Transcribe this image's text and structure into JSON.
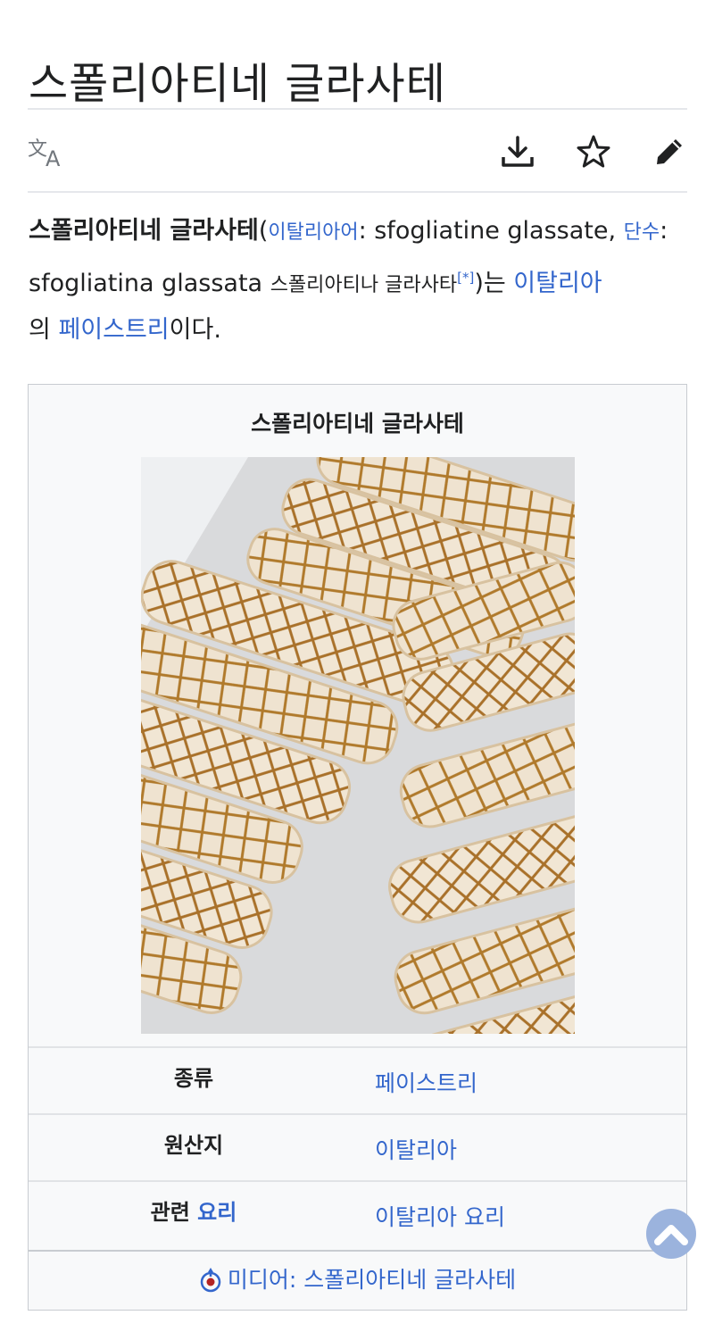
{
  "page": {
    "title": "스폴리아티네 글라사테"
  },
  "toolbar": {
    "language_icon": "translate-icon",
    "download_icon": "download-icon",
    "watch_icon": "star-icon",
    "edit_icon": "pencil-icon"
  },
  "intro": {
    "bold_title": "스폴리아티네 글라사테",
    "paren_open": "(",
    "lang_link": "이탈리아어",
    "italian_name": ": sfogliatine glassate, ",
    "singular_link": "단수",
    "singular_name": ": sfogliatina glassata ",
    "small_name": "스폴리아티나 글라사타",
    "footnote": "[*]",
    "paren_close": ")는 ",
    "country_link": "이탈리아",
    "particle": "의 ",
    "pastry_link": "페이스트리",
    "ending": "이다."
  },
  "infobox": {
    "title": "스폴리아티네 글라사테",
    "image_alt": "sfogliatine glassate photo",
    "rows": [
      {
        "key": "종류",
        "key_link": "",
        "value": "페이스트리"
      },
      {
        "key": "원산지",
        "key_link": "",
        "value": "이탈리아"
      },
      {
        "key": "관련 ",
        "key_link": "요리",
        "value": "이탈리아 요리"
      }
    ],
    "media_icon": "commons-icon",
    "media_link": "미디어: 스폴리아티네 글라사테"
  },
  "scroll_top_icon": "chevron-up-icon",
  "colors": {
    "link": "#3366cc",
    "text": "#202122",
    "infobox_bg": "#f8f9fa",
    "border": "#c8ccd1"
  }
}
